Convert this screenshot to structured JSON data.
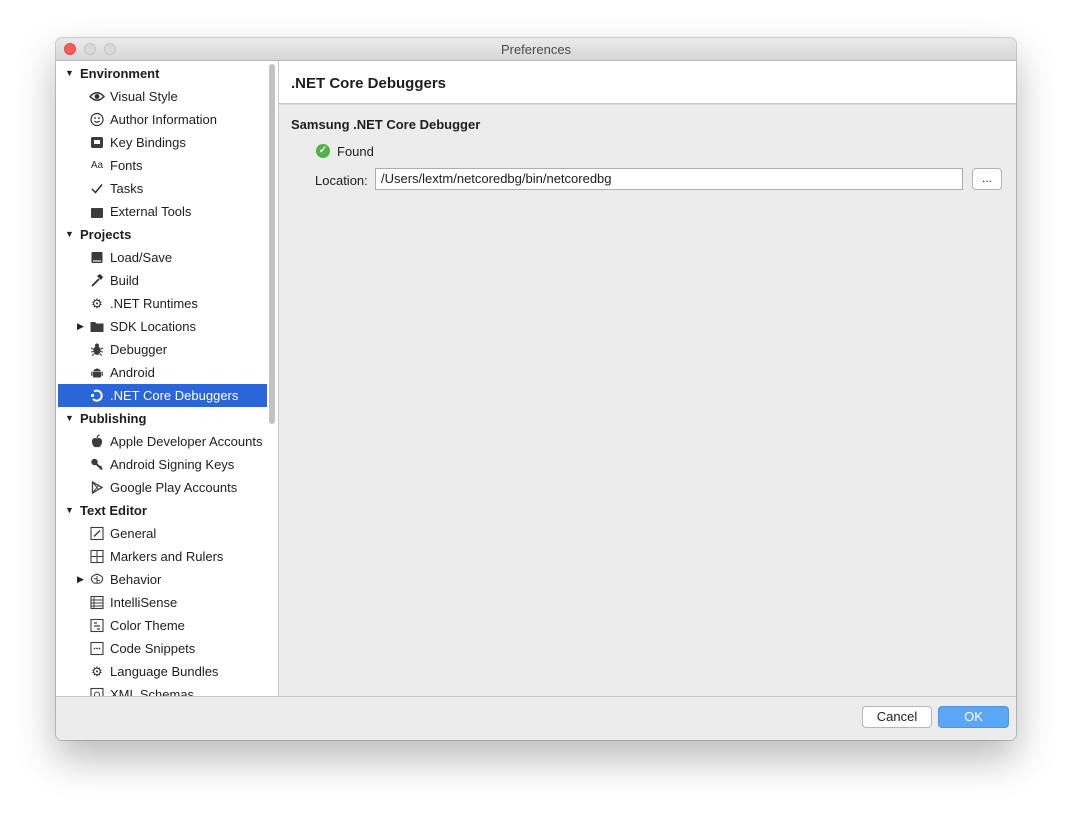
{
  "window": {
    "title": "Preferences"
  },
  "sidebar": {
    "groups": [
      {
        "label": "Environment",
        "items": [
          {
            "label": "Visual Style",
            "icon": "eye-icon"
          },
          {
            "label": "Author Information",
            "icon": "smiley-icon"
          },
          {
            "label": "Key Bindings",
            "icon": "keyboard-icon"
          },
          {
            "label": "Fonts",
            "icon": "fonts-icon"
          },
          {
            "label": "Tasks",
            "icon": "checkmark-icon"
          },
          {
            "label": "External Tools",
            "icon": "terminal-icon"
          }
        ]
      },
      {
        "label": "Projects",
        "items": [
          {
            "label": "Load/Save",
            "icon": "disk-icon"
          },
          {
            "label": "Build",
            "icon": "hammer-icon"
          },
          {
            "label": ".NET Runtimes",
            "icon": "gear-icon"
          },
          {
            "label": "SDK Locations",
            "icon": "folder-icon",
            "expandable": true
          },
          {
            "label": "Debugger",
            "icon": "bug-icon"
          },
          {
            "label": "Android",
            "icon": "android-icon"
          },
          {
            "label": ".NET Core Debuggers",
            "icon": "samsung-debugger-icon",
            "selected": true
          }
        ]
      },
      {
        "label": "Publishing",
        "items": [
          {
            "label": "Apple Developer Accounts",
            "icon": "apple-icon"
          },
          {
            "label": "Android Signing Keys",
            "icon": "key-icon"
          },
          {
            "label": "Google Play Accounts",
            "icon": "play-icon"
          }
        ]
      },
      {
        "label": "Text Editor",
        "items": [
          {
            "label": "General",
            "icon": "edit-icon"
          },
          {
            "label": "Markers and Rulers",
            "icon": "grid-icon"
          },
          {
            "label": "Behavior",
            "icon": "brain-icon",
            "expandable": true
          },
          {
            "label": "IntelliSense",
            "icon": "list-icon"
          },
          {
            "label": "Color Theme",
            "icon": "palette-icon"
          },
          {
            "label": "Code Snippets",
            "icon": "snippet-icon"
          },
          {
            "label": "Language Bundles",
            "icon": "gear-icon"
          },
          {
            "label": "XML Schemas",
            "icon": "schema-icon"
          }
        ]
      }
    ]
  },
  "content": {
    "page_title": ".NET Core Debuggers",
    "section_title": "Samsung .NET Core Debugger",
    "status": "Found",
    "location_label": "Location:",
    "location_value": "/Users/lextm/netcoredbg/bin/netcoredbg",
    "browse_label": "..."
  },
  "footer": {
    "cancel_label": "Cancel",
    "ok_label": "OK"
  },
  "colors": {
    "selection": "#2a65d9",
    "ok_button": "#5aa8f5",
    "found_status": "#4fb34a",
    "close_button": "#fc5f57"
  }
}
